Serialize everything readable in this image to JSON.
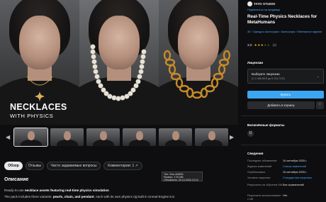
{
  "gallery": {
    "title": "NECKLACES",
    "subtitle": "WITH PHYSICS",
    "thumbnail_count": 6,
    "active_thumbnail": 1,
    "prev_icon": "chevron-left-icon",
    "next_icon": "chevron-right-icon"
  },
  "tabs": [
    {
      "label": "Обзор",
      "active": true
    },
    {
      "label": "Отзывы",
      "active": false
    },
    {
      "label": "Часто задаваемые вопросы",
      "active": false
    },
    {
      "label": "Комментарии: 1",
      "active": false
    }
  ],
  "tooltip": {
    "line1": "Тип: Хеш-MARM",
    "line2": "Размер: 1.00 МБ",
    "line3": "Обновлено: 20.10.2025 10:10"
  },
  "description": {
    "heading": "Описание",
    "line1_prefix": "Ready-to-use ",
    "line1_bold": "necklace assets featuring real-time physics simulation",
    "line2_prefix": "The pack includes three variants: ",
    "line2_bold": "pearls, chain, and pendant",
    "line2_suffix": ", each with its own physics rig built in Unreal Engine 5.6."
  },
  "seller": {
    "name": "TATO STUDIO",
    "follow_link": "Подписаться на продавца"
  },
  "product": {
    "title": "Real-Time Physics Necklaces for MetaHumans",
    "breadcrumbs": "3D › Одежда и аксессуары › Аксессуары › Ювелирные изделия",
    "rating": "3,0",
    "stars_filled": 3,
    "stars_total": 5,
    "review_count": "(2)"
  },
  "license": {
    "heading": "Лицензии",
    "placeholder": "Выберите лицензию",
    "price_range": "(С 2 495,95 ₽ до 6 724,73 ₽)",
    "buy_label": "Купить",
    "cart_label": "Добавить в корзину",
    "favorite_icon": "heart-icon"
  },
  "formats": {
    "heading": "Включённые форматы",
    "icon": "unreal-engine-icon"
  },
  "details": {
    "heading": "Сведения",
    "rows": [
      {
        "key": "Последнее обновление",
        "value": "10 сентября 2025 г.",
        "link": false
      },
      {
        "key": "Журнал изменений",
        "value": "Список изменений",
        "link": true
      },
      {
        "key": "Опубликовано",
        "value": "10 сентября 2025 г.",
        "link": false
      },
      {
        "key": "Условия лицензии",
        "value": "Стандартная лицензия",
        "link": true
      },
      {
        "key": "Разрешено ли обучение ИИ",
        "value": "Без ограничений",
        "link": false
      },
      {
        "key": "Разрешено использование с ИИ",
        "value": "Нет",
        "link": false
      }
    ]
  }
}
